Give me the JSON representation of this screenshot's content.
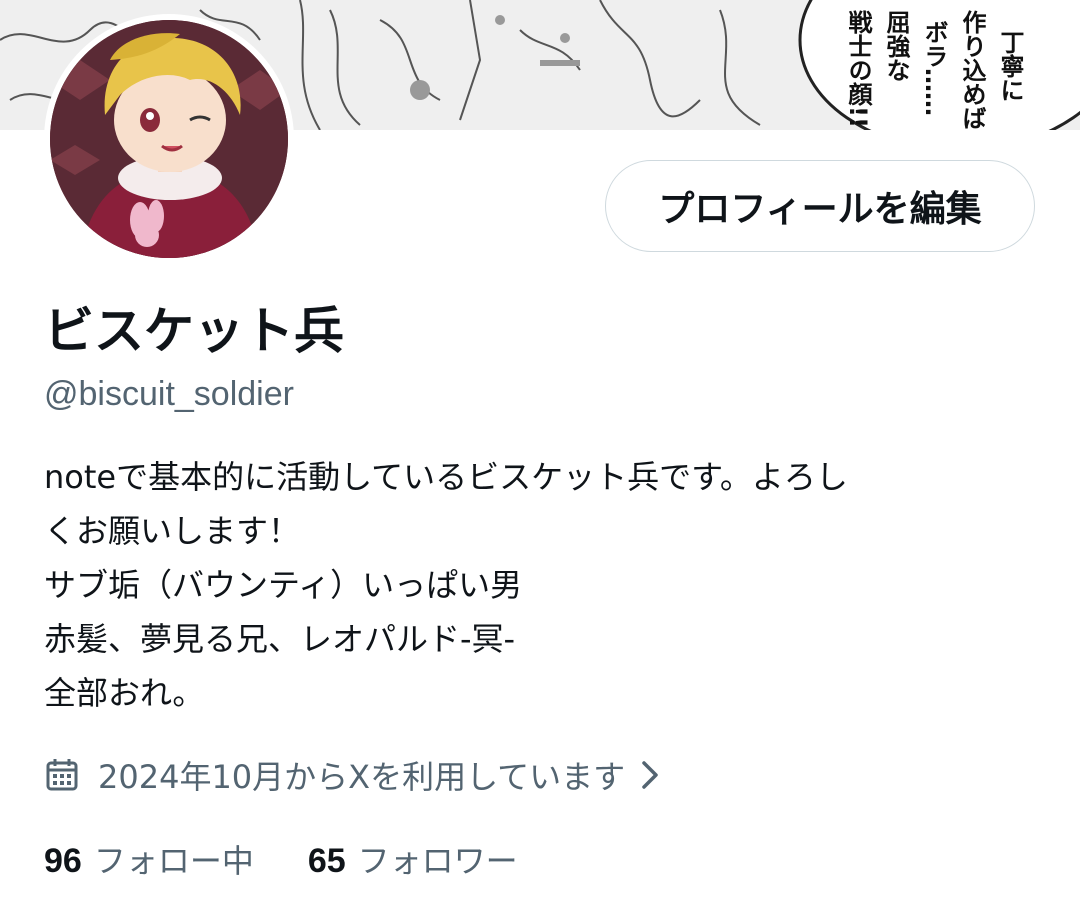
{
  "profile": {
    "edit_button_label": "プロフィールを編集",
    "display_name": "ビスケット兵",
    "handle": "@biscuit_soldier",
    "bio_lines": [
      "noteで基本的に活動しているビスケット兵です。よろし",
      "くお願いします！",
      "サブ垢（バウンティ）いっぱい男",
      "赤髪、夢見る兄、レオパルド-冥-",
      "全部おれ。"
    ],
    "joined_text": "2024年10月からXを利用しています",
    "following_count": "96",
    "following_label": "フォロー中",
    "followers_count": "65",
    "followers_label": "フォロワー"
  },
  "banner": {
    "speech_text_lines": [
      "丁寧に",
      "作り込めば",
      "ボラ……",
      "屈強な",
      "戦士の顔!!"
    ]
  },
  "icons": {
    "calendar": "calendar-icon",
    "chevron": "chevron-right-icon"
  },
  "colors": {
    "text_primary": "#0f1419",
    "text_secondary": "#536471",
    "button_border": "#cfd9de"
  }
}
